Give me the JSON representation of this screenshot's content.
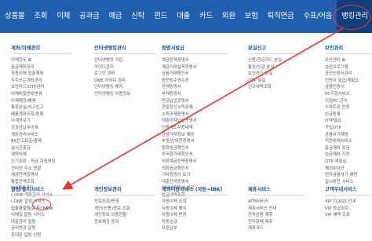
{
  "nav": {
    "items": [
      "상품몰",
      "조회",
      "이체",
      "공과금",
      "예금",
      "신탁",
      "펀드",
      "대출",
      "카드",
      "외환",
      "보험",
      "퇴직연금",
      "수표/어음",
      "뱅킹관리"
    ],
    "active_index": 13,
    "color": "#1f5fae"
  },
  "menu": {
    "col1": {
      "head": "계좌/이체관리",
      "items": [
        "이체한도 ⊞",
        "출금계좌관리",
        "자동이체 입출계좌",
        "자주쓰는계좌관리",
        "보안카드/OTP관리",
        "이체비밀번호변경",
        "이체제한/해제",
        "통장분실/사고신고",
        "배움계좌조회/등록",
        "다계좌보기",
        "공과금납부이체",
        "계좌관리서비스",
        "BK잔고표출/결제",
        "실시간출금",
        "예약이체",
        "인기조회 · 적금 자동연장",
        "인터넷 주소 연결",
        "예금잔액증명서",
        "통합잔액조회",
        "ISA계좌관리",
        "i-ONE 계좌관리 서비스"
      ]
    },
    "col2": {
      "head": "인터넷뱅킹관리",
      "items": [
        "인터넷뱅킹 가입",
        "아이디관리",
        "로그인 관리",
        "ONE 아이디 관리",
        "인터넷뱅킹 해지",
        "인터넷뱅킹 이용정보"
      ]
    },
    "col3": {
      "head": "증명서발급",
      "items": [
        "예금잔액증명서",
        "예금거래실적증명서",
        "금융거래확인서",
        "원천징수영수증",
        "잔액증명서",
        "부채증명서",
        "연금납입증명서",
        "연말정산소득공제",
        "소득공제증명서",
        "대출이자납입증명서",
        "신용카드사용내역",
        "금융거래정보 제공",
        "부동산/외환증명서",
        "원화송금확인서",
        "외국환거래확인서",
        "외화예금잔액증명서",
        "외화송금확인서",
        "기타증명서 보기",
        "대출잔액증명서",
        "인터넷증명서 발급",
        "발급내역조회"
      ]
    },
    "col4": {
      "head": "분실신고",
      "items": [
        "신용/현금카드 분실",
        "통장/인감 분실",
        "보안카드 분실",
        "OTP 분실",
        "신고내역조회"
      ]
    },
    "col5": {
      "head": "보안관리",
      "items": [
        "보안센터 ⊞",
        "보안프로그램",
        "공인인증서관리",
        "인증서 발급/재발급",
        "금융인증서",
        "PC지정서비스",
        "지정PC 관리",
        "스마트폰 인증",
        "신규등록",
        "OTP발급",
        "구입OTP",
        "금융사기예방",
        "지연이체서비스",
        "출금계좌 잠금",
        "입금계좌 지정",
        "OTP 재발급",
        "해외IP차단",
        "전자금융사기 예방",
        "일시차단 서비스"
      ]
    },
    "row2": [
      {
        "head": "알림/통지서비스",
        "items": [
          "i-ONE 알림 서비스",
          "입출금알림(문자) NEW",
          "이메일 알림 서비스",
          "대출금리 알림",
          "금리변경 알림",
          "휴대폰 알림 신청"
        ],
        "highlight_index": 1
      },
      {
        "head": "개인정보관리",
        "items": [
          "정보조회/변경",
          "개인(신용)정보 조회",
          "개인정보 이용현황",
          "정보제공 동의"
        ]
      },
      {
        "head": "계좌이동서비스 (자동→IBK)",
        "items": [
          "자동이체 조회",
          "자동이체 해지",
          "자동이체 변경",
          "자동송금",
          "자동납부"
        ]
      },
      {
        "head": "제휴서비스",
        "items": [
          "ATM서비스",
          "제휴서비스 안내",
          "전자금융 제휴",
          "전자화폐 제휴",
          "제휴카드"
        ]
      },
      {
        "head": "고객우대서비스",
        "items": [
          "VIP CLASS 안내",
          "VIP 등급조회",
          "VIP 혜택 조회"
        ]
      }
    ]
  }
}
